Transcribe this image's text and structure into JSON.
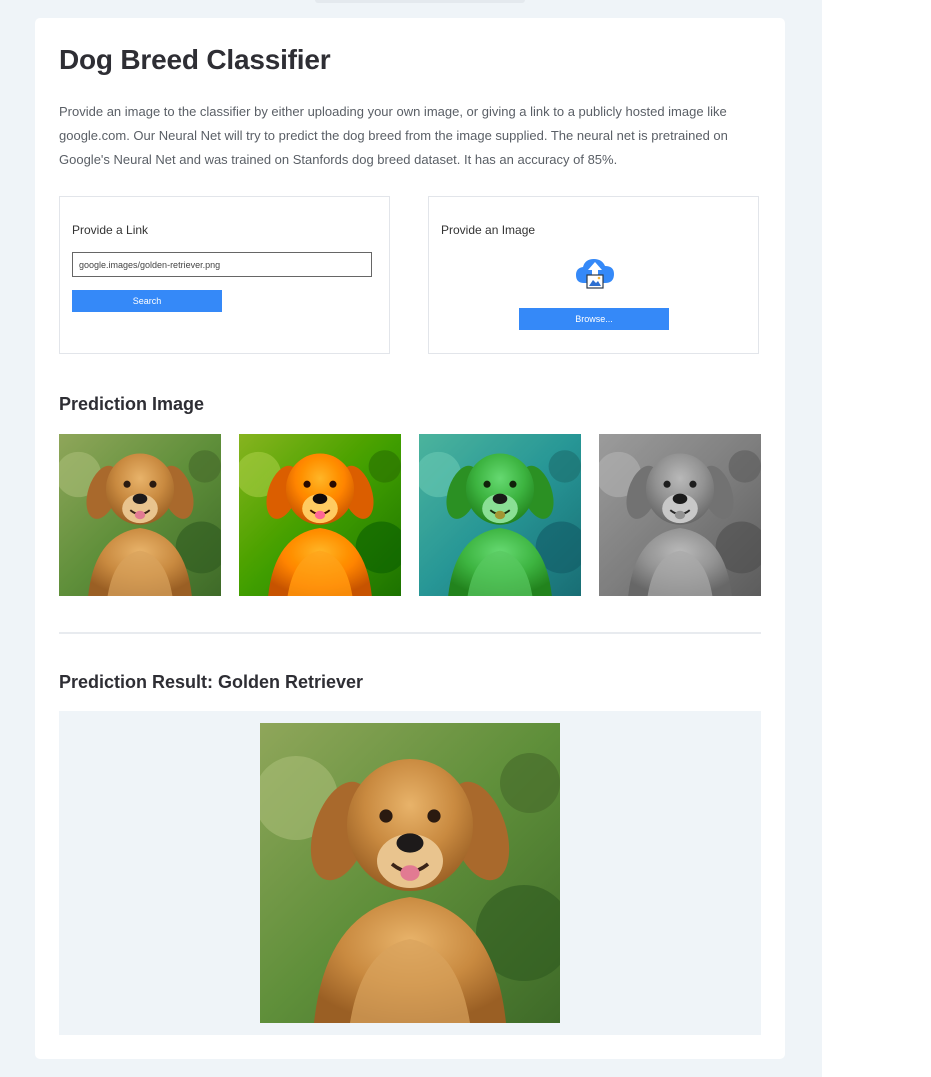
{
  "page": {
    "title": "Dog Breed Classifier",
    "intro": "Provide an image to the classifier by either uploading your own image, or giving a link to a publicly hosted image like google.com. Our Neural Net will try to predict the dog breed from the image supplied. The neural net is pretrained on Google's Neural Net and was trained on Stanfords dog breed dataset. It has an accuracy of 85%."
  },
  "link_panel": {
    "label": "Provide a Link",
    "input_value": "google.images/golden-retriever.png",
    "search_label": "Search"
  },
  "image_panel": {
    "label": "Provide an Image",
    "upload_icon": "cloud-upload-icon",
    "browse_label": "Browse..."
  },
  "prediction_images": {
    "title": "Prediction Image",
    "items": [
      {
        "variant": "original"
      },
      {
        "variant": "saturated"
      },
      {
        "variant": "green-tint"
      },
      {
        "variant": "grayscale"
      }
    ]
  },
  "prediction_result": {
    "title": "Prediction Result: Golden Retriever"
  },
  "colors": {
    "accent": "#3589f8",
    "page_background": "#eff4f8",
    "card": "#ffffff",
    "heading": "#2e2e34"
  }
}
